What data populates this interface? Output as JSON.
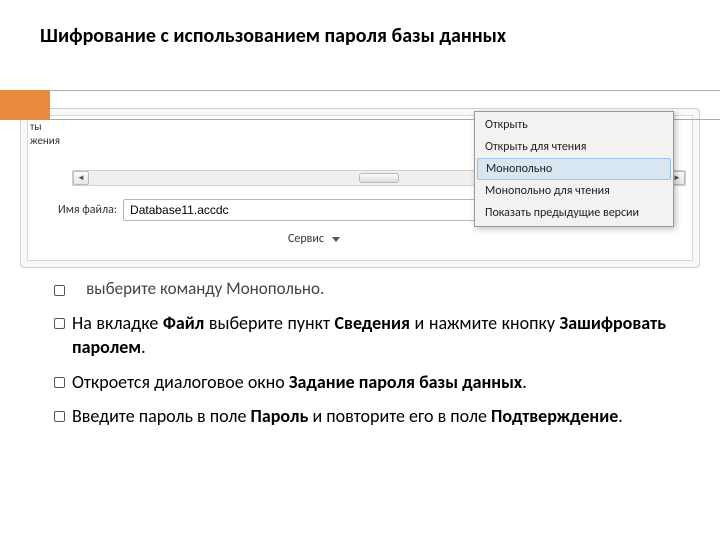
{
  "title": "Шифрование с использованием пароля базы данных",
  "screenshot": {
    "left_text1": "ты",
    "left_text2": "жения",
    "filename_label": "Имя файла:",
    "filename_value": "Database11.accdc",
    "service_label": "Сервис",
    "menu": {
      "open": "Открыть",
      "open_read": "Открыть для чтения",
      "exclusive": "Монопольно",
      "exclusive_read": "Монопольно для чтения",
      "prev_versions": "Показать предыдущие версии"
    }
  },
  "bullets": {
    "partial": "выберите команду Монопольно.",
    "b1_a": "На вкладке ",
    "b1_file": "Файл",
    "b1_b": " выберите пункт ",
    "b1_info": "Сведения",
    "b1_c": " и нажмите кнопку ",
    "b1_encrypt": "Зашифровать паролем",
    "b1_d": ".",
    "b2_a": "Откроется диалоговое окно ",
    "b2_dlg": "Задание пароля базы данных",
    "b2_b": ".",
    "b3_a": "Введите пароль в поле ",
    "b3_pw": "Пароль",
    "b3_b": " и повторите его в поле ",
    "b3_conf": "Подтверждение",
    "b3_c": "."
  }
}
